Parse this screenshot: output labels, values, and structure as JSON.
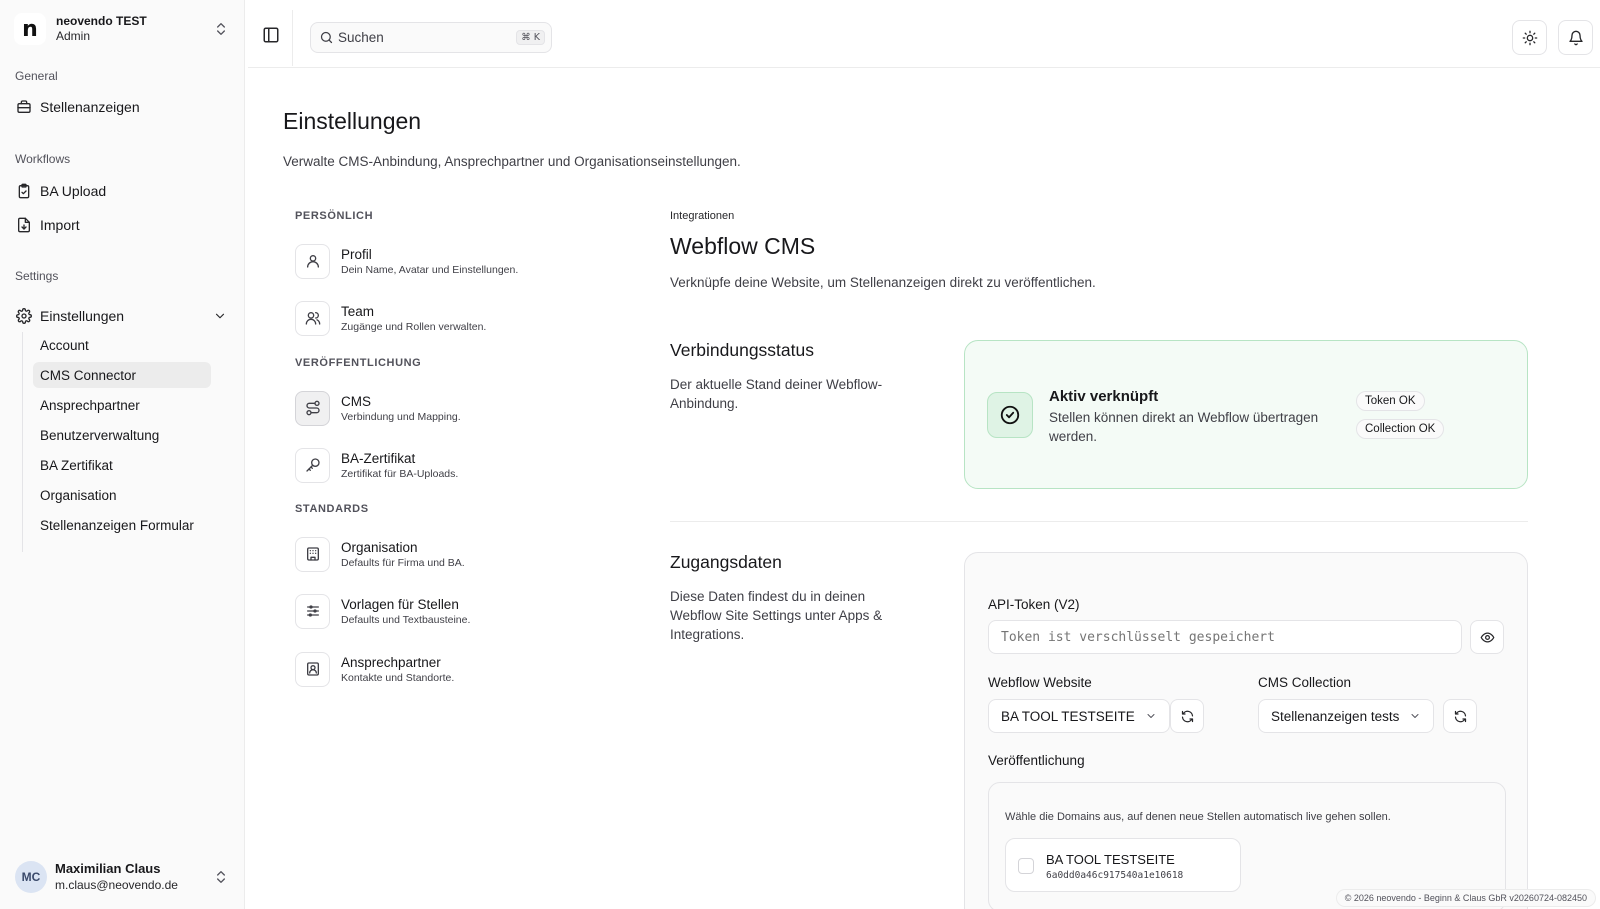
{
  "org": {
    "name": "neovendo TEST",
    "role": "Admin",
    "logo_letter": "n"
  },
  "sidebar": {
    "general_label": "General",
    "general_items": [
      {
        "label": "Stellenanzeigen",
        "icon": "briefcase-icon"
      }
    ],
    "workflows_label": "Workflows",
    "workflow_items": [
      {
        "label": "BA Upload",
        "icon": "clipboard-check-icon"
      },
      {
        "label": "Import",
        "icon": "file-import-icon"
      }
    ],
    "settings_label": "Settings",
    "settings_item": {
      "label": "Einstellungen",
      "icon": "gear-icon",
      "expanded": true
    },
    "sub_items": [
      {
        "label": "Account",
        "active": false
      },
      {
        "label": "CMS Connector",
        "active": true
      },
      {
        "label": "Ansprechpartner",
        "active": false
      },
      {
        "label": "Benutzerverwaltung",
        "active": false
      },
      {
        "label": "BA Zertifikat",
        "active": false
      },
      {
        "label": "Organisation",
        "active": false
      },
      {
        "label": "Stellenanzeigen Formular",
        "active": false
      }
    ]
  },
  "user": {
    "initials": "MC",
    "name": "Maximilian Claus",
    "email": "m.claus@neovendo.de"
  },
  "header": {
    "search_placeholder": "Suchen",
    "shortcut": "⌘ K",
    "theme_icon": "sun-icon",
    "bell_icon": "bell-icon"
  },
  "page": {
    "title": "Einstellungen",
    "subtitle": "Verwalte CMS-Anbindung, Ansprechpartner und Organisationseinstellungen."
  },
  "settings_menu": {
    "groups": [
      {
        "label": "PERSÖNLICH",
        "items": [
          {
            "title": "Profil",
            "desc": "Dein Name, Avatar und Einstellungen.",
            "icon": "user-icon",
            "active": false
          },
          {
            "title": "Team",
            "desc": "Zugänge und Rollen verwalten.",
            "icon": "users-icon",
            "active": false
          }
        ]
      },
      {
        "label": "VERÖFFENTLICHUNG",
        "items": [
          {
            "title": "CMS",
            "desc": "Verbindung und Mapping.",
            "icon": "route-icon",
            "active": true
          },
          {
            "title": "BA-Zertifikat",
            "desc": "Zertifikat für BA-Uploads.",
            "icon": "key-icon",
            "active": false
          }
        ]
      },
      {
        "label": "STANDARDS",
        "items": [
          {
            "title": "Organisation",
            "desc": "Defaults für Firma und BA.",
            "icon": "building-icon",
            "active": false
          },
          {
            "title": "Vorlagen für Stellen",
            "desc": "Defaults und Textbausteine.",
            "icon": "sliders-icon",
            "active": false
          },
          {
            "title": "Ansprechpartner",
            "desc": "Kontakte und Standorte.",
            "icon": "contact-icon",
            "active": false
          }
        ]
      }
    ]
  },
  "main": {
    "crumb": "Integrationen",
    "title": "Webflow CMS",
    "lead": "Verknüpfe deine Website, um Stellenanzeigen direkt zu veröffentlichen.",
    "status": {
      "title": "Verbindungsstatus",
      "desc": "Der aktuelle Stand deiner Webflow-Anbindung.",
      "state_title": "Aktiv verknüpft",
      "state_text": "Stellen können direkt an Webflow übertragen werden.",
      "badges": [
        "Token OK",
        "Collection OK"
      ],
      "accent": "#b7e4c4"
    },
    "credentials": {
      "title": "Zugangsdaten",
      "desc": "Diese Daten findest du in deinen Webflow Site Settings unter Apps & Integrations.",
      "token_label": "API-Token (V2)",
      "token_placeholder": "Token ist verschlüsselt gespeichert",
      "website_label": "Webflow Website",
      "website_value": "BA TOOL TESTSEITE",
      "collection_label": "CMS Collection",
      "collection_value": "Stellenanzeigen tests",
      "publish_label": "Veröffentlichung",
      "publish_hint": "Wähle die Domains aus, auf denen neue Stellen automatisch live gehen sollen.",
      "domain_name": "BA TOOL TESTSEITE",
      "domain_id": "6a0dd0a46c917540a1e10618"
    }
  },
  "footer": "© 2026 neovendo - Beginn & Claus GbR v20260724-082450"
}
